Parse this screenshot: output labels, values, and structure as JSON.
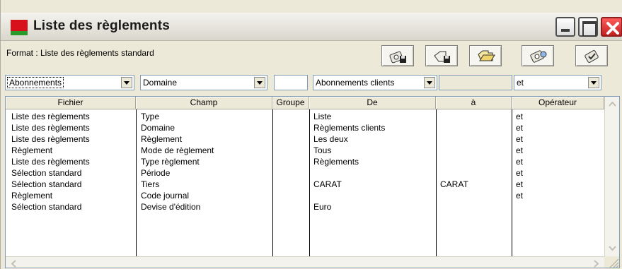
{
  "window": {
    "title": "Liste des règlements",
    "accent_colors": {
      "icon_red": "#d7101b",
      "icon_green": "#2a9a2a",
      "close_red": "#c61f1f"
    }
  },
  "toolbar": {
    "format_label": "Format : Liste des règlements standard",
    "buttons": [
      {
        "name": "save-format-icon"
      },
      {
        "name": "save-as-format-icon"
      },
      {
        "name": "open-format-icon"
      },
      {
        "name": "format-settings-icon"
      },
      {
        "name": "validate-format-icon"
      }
    ]
  },
  "filters": {
    "fichier": "Abonnements",
    "champ": "Domaine",
    "groupe": "",
    "de": "Abonnements clients",
    "a": "",
    "operateur": "et"
  },
  "table": {
    "headers": [
      "Fichier",
      "Champ",
      "Groupe",
      "De",
      "à",
      "Opérateur"
    ],
    "rows": [
      [
        "Liste des règlements",
        "Type",
        "",
        "Liste",
        "",
        "et"
      ],
      [
        "Liste des règlements",
        "Domaine",
        "",
        "Règlements clients",
        "",
        "et"
      ],
      [
        "Liste des règlements",
        "Règlement",
        "",
        "Les deux",
        "",
        "et"
      ],
      [
        "Règlement",
        "Mode de règlement",
        "",
        "Tous",
        "",
        "et"
      ],
      [
        "Liste des règlements",
        "Type règlement",
        "",
        "Règlements",
        "",
        "et"
      ],
      [
        "Sélection standard",
        "Période",
        "",
        "",
        "",
        "et"
      ],
      [
        "Sélection standard",
        "Tiers",
        "",
        "CARAT",
        "CARAT",
        "et"
      ],
      [
        "Règlement",
        "Code journal",
        "",
        "",
        "",
        "et"
      ],
      [
        "Sélection standard",
        "Devise d'édition",
        "",
        "Euro",
        "",
        ""
      ]
    ]
  }
}
